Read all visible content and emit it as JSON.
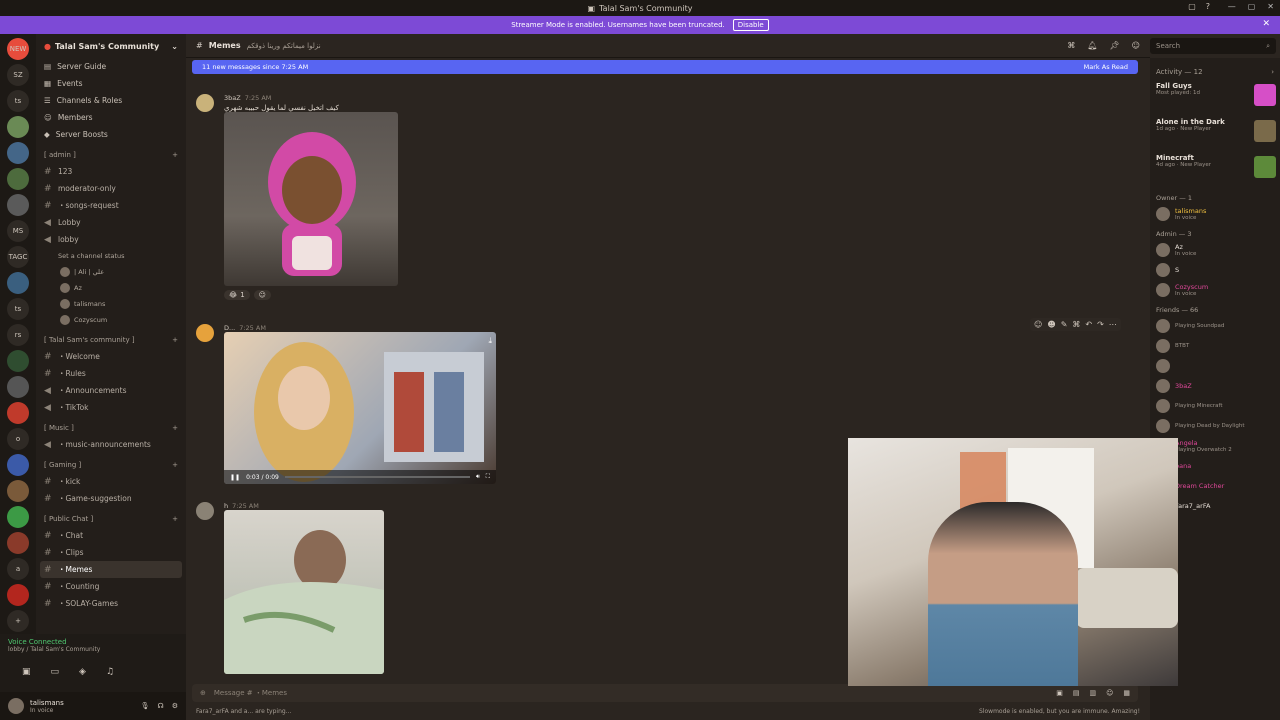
{
  "window": {
    "title": "Talal Sam's Community"
  },
  "streamer_bar": {
    "message": "Streamer Mode is enabled. Usernames have been truncated.",
    "disable_label": "Disable"
  },
  "guilds": [
    {
      "label": "NEW",
      "color": "#e74c3c"
    },
    {
      "label": "SZ",
      "color": "#2f2a25"
    },
    {
      "label": "ts",
      "color": "#2f2a25"
    },
    {
      "label": "",
      "color": "#6a8a55"
    },
    {
      "label": "",
      "color": "#446688"
    },
    {
      "label": "",
      "color": "#4d6b3d"
    },
    {
      "label": "",
      "color": "#5a5a5a"
    },
    {
      "label": "MS",
      "color": "#2f2a25"
    },
    {
      "label": "TAGC",
      "color": "#2f2a25"
    },
    {
      "label": "",
      "color": "#3a5f7f"
    },
    {
      "label": "ts",
      "color": "#2f2a25"
    },
    {
      "label": "rs",
      "color": "#2f2a25"
    },
    {
      "label": "",
      "color": "#2f4d30"
    },
    {
      "label": "",
      "color": "#555"
    },
    {
      "label": "",
      "color": "#c03a2b"
    },
    {
      "label": "o",
      "color": "#2f2a25"
    },
    {
      "label": "",
      "color": "#3b5aa8"
    },
    {
      "label": "",
      "color": "#7a5a3a"
    },
    {
      "label": "",
      "color": "#3c9a45"
    },
    {
      "label": "",
      "color": "#8a3a2a"
    },
    {
      "label": "a",
      "color": "#2f2a25"
    },
    {
      "label": "",
      "color": "#b3261e"
    },
    {
      "label": "+",
      "color": "#2f2a25"
    },
    {
      "label": "⌕",
      "color": "#2f2a25"
    }
  ],
  "server": {
    "name": "Talal Sam's Community",
    "nav": [
      {
        "label": "Server Guide",
        "icon": "book-icon",
        "glyph": "▤"
      },
      {
        "label": "Events",
        "icon": "calendar-icon",
        "glyph": "▦"
      },
      {
        "label": "Channels & Roles",
        "icon": "list-icon",
        "glyph": "☰"
      },
      {
        "label": "Members",
        "icon": "members-icon",
        "glyph": "☺"
      },
      {
        "label": "Server Boosts",
        "icon": "boost-icon",
        "glyph": "◆"
      }
    ],
    "categories": [
      {
        "name": "[ admin ]",
        "channels": [
          {
            "name": "123",
            "type": "text"
          },
          {
            "name": "moderator-only",
            "type": "text"
          },
          {
            "name": "・songs-request",
            "type": "text"
          },
          {
            "name": "Lobby",
            "type": "voice"
          },
          {
            "name": "lobby",
            "type": "voice",
            "status": "Set a channel status",
            "users": [
              "| Ali | علي",
              "Az",
              "talismans",
              "Cozyscum"
            ]
          }
        ]
      },
      {
        "name": "[ Talal Sam's community ]",
        "channels": [
          {
            "name": "・Welcome",
            "type": "text"
          },
          {
            "name": "・Rules",
            "type": "text"
          },
          {
            "name": "・Announcements",
            "type": "voice"
          },
          {
            "name": "・TikTok",
            "type": "voice"
          }
        ]
      },
      {
        "name": "[ Music ]",
        "channels": [
          {
            "name": "・music-announcements",
            "type": "voice"
          }
        ]
      },
      {
        "name": "[ Gaming ]",
        "channels": [
          {
            "name": "・kick",
            "type": "text"
          },
          {
            "name": "・Game-suggestion",
            "type": "text"
          }
        ]
      },
      {
        "name": "[ Public Chat ]",
        "channels": [
          {
            "name": "・Chat",
            "type": "text"
          },
          {
            "name": "・Clips",
            "type": "text"
          },
          {
            "name": "・Memes",
            "type": "text",
            "active": true
          },
          {
            "name": "・Counting",
            "type": "text"
          },
          {
            "name": "・SOLAY-Games",
            "type": "text"
          }
        ]
      }
    ]
  },
  "voice": {
    "status": "Voice Connected",
    "location": "lobby / Talal Sam's Community"
  },
  "user": {
    "name": "talismans",
    "status": "In voice"
  },
  "channel": {
    "name": "Memes",
    "topic": "نزلوا ميماتكم ورينا ذوقكم"
  },
  "search": {
    "placeholder": "Search"
  },
  "new_messages": {
    "text": "11 new messages since 7:25 AM",
    "mark_read": "Mark As Read"
  },
  "messages": [
    {
      "author": "3baZ",
      "time": "7:25 AM",
      "text": "كيف اتخيل نفسي لما يقول حبيبه شهري",
      "reaction_count": "1"
    },
    {
      "author": "D...",
      "time": "7:25 AM",
      "text": "",
      "video_time": "0:03 / 0:09"
    },
    {
      "author": "h",
      "time": "7:25 AM",
      "text": ""
    }
  ],
  "composer": {
    "placeholder": "Message # ・Memes"
  },
  "typing": "Fara7_arFA and a... are typing...",
  "slowmode": "Slowmode is enabled, but you are immune. Amazing!",
  "members_panel": {
    "activity_label": "Activity — 12",
    "activities": [
      {
        "game": "Fall Guys",
        "sub": "Most played: 1d",
        "color": "#d64fc7"
      },
      {
        "game": "Alone in the Dark",
        "sub": "1d ago · New Player",
        "color": "#7a6a4a"
      },
      {
        "game": "Minecraft",
        "sub": "4d ago · New Player",
        "color": "#5d8a3a"
      }
    ],
    "groups": [
      {
        "label": "Owner — 1",
        "members": [
          {
            "name": "talismans",
            "status": "In voice",
            "color": "#f0c040"
          }
        ]
      },
      {
        "label": "Admin — 3",
        "members": [
          {
            "name": "Az",
            "status": "In voice",
            "color": "#e8e0d8"
          },
          {
            "name": "S",
            "status": "",
            "color": "#e8e0d8"
          },
          {
            "name": "Cozyscum",
            "status": "In voice",
            "color": "#e0489a"
          }
        ]
      },
      {
        "label": "Friends — 66",
        "members": [
          {
            "name": "",
            "status": "Playing Soundpad",
            "color": "#e8e0d8"
          },
          {
            "name": "",
            "status": "BTBT",
            "color": "#e8e0d8"
          },
          {
            "name": "",
            "status": "",
            "color": "#e8e0d8"
          },
          {
            "name": "3baZ",
            "status": "",
            "color": "#e0489a"
          },
          {
            "name": "",
            "status": "Playing Minecraft",
            "color": "#e8e0d8"
          },
          {
            "name": "",
            "status": "Playing Dead by Daylight",
            "color": "#e8e0d8"
          },
          {
            "name": "Angela",
            "status": "Playing Overwatch 2",
            "color": "#e0489a"
          },
          {
            "name": "bana",
            "status": "",
            "color": "#e0489a"
          },
          {
            "name": "Dream Catcher",
            "status": "",
            "color": "#e0489a"
          },
          {
            "name": "Fara7_arFA",
            "status": "",
            "color": "#e8e0d8"
          }
        ]
      }
    ]
  }
}
